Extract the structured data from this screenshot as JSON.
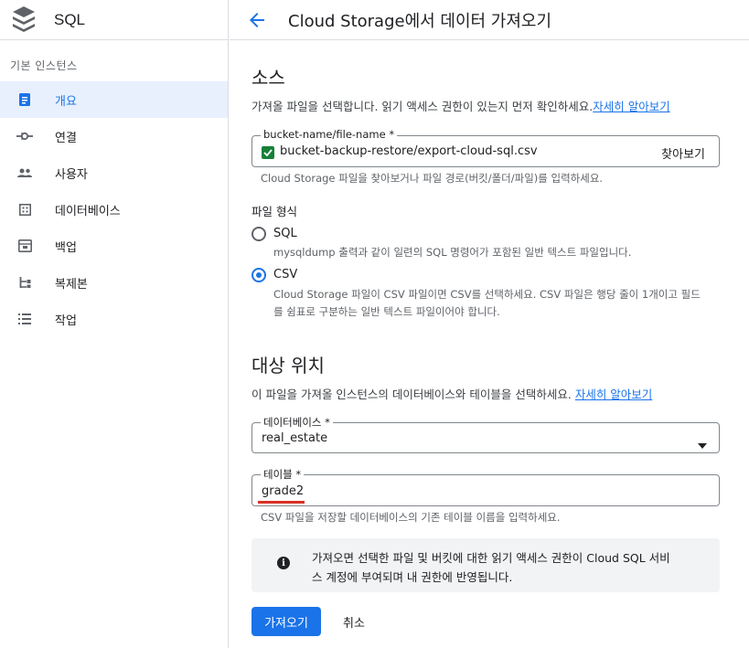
{
  "sidebar": {
    "product": "SQL",
    "section_title": "기본 인스턴스",
    "items": [
      {
        "label": "개요",
        "active": true
      },
      {
        "label": "연결"
      },
      {
        "label": "사용자"
      },
      {
        "label": "데이터베이스"
      },
      {
        "label": "백업"
      },
      {
        "label": "복제본"
      },
      {
        "label": "작업"
      }
    ]
  },
  "header": {
    "title": "Cloud Storage에서 데이터 가져오기"
  },
  "source": {
    "heading": "소스",
    "description": "가져올 파일을 선택합니다. 읽기 액세스 권한이 있는지 먼저 확인하세요.",
    "learn_more": "자세히 알아보기",
    "file_label": "bucket-name/file-name *",
    "file_value": "bucket-backup-restore/export-cloud-sql.csv",
    "browse": "찾아보기",
    "file_hint": "Cloud Storage 파일을 찾아보거나 파일 경로(버킷/폴더/파일)를 입력하세요."
  },
  "file_format": {
    "label": "파일 형식",
    "options": [
      {
        "name": "SQL",
        "desc": "mysqldump 출력과 같이 일련의 SQL 명령어가 포함된 일반 텍스트 파일입니다.",
        "selected": false
      },
      {
        "name": "CSV",
        "desc_line1": "Cloud Storage 파일이 CSV 파일이면 CSV를 선택하세요. CSV 파일은 행당 줄이 1개이고 필드",
        "desc_line2": "를 쉼표로 구분하는 일반 텍스트 파일이어야 합니다.",
        "selected": true
      }
    ]
  },
  "destination": {
    "heading": "대상 위치",
    "description": "이 파일을 가져올 인스턴스의 데이터베이스와 테이블을 선택하세요.",
    "learn_more": "자세히 알아보기",
    "database_label": "데이터베이스 *",
    "database_value": "real_estate",
    "table_label": "테이블 *",
    "table_value": "grade2",
    "table_hint": "CSV 파일을 저장할 데이터베이스의 기존 테이블 이름을 입력하세요."
  },
  "info": {
    "line1": "가져오면 선택한 파일 및 버킷에 대한 읽기 액세스 권한이 Cloud SQL 서비",
    "line2": "스 계정에 부여되며 내 권한에 반영됩니다."
  },
  "actions": {
    "import": "가져오기",
    "cancel": "취소"
  },
  "colors": {
    "accent": "#1a73e8",
    "success": "#188038",
    "underline": "#d93025"
  }
}
